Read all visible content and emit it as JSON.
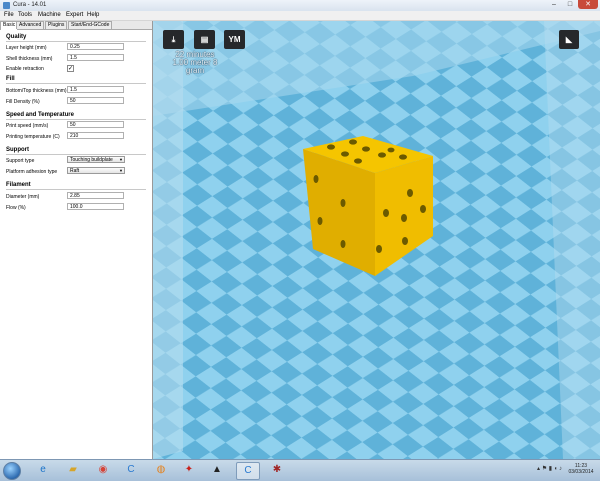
{
  "window": {
    "title": "Cura - 14.01",
    "minimize": "–",
    "maximize": "□",
    "close": "✕"
  },
  "menu": [
    "File",
    "Tools",
    "Machine",
    "Expert",
    "Help"
  ],
  "tabs": [
    "Basic",
    "Advanced",
    "Plugins",
    "Start/End-GCode"
  ],
  "sections": {
    "quality": {
      "title": "Quality",
      "layer_height": {
        "label": "Layer height (mm)",
        "value": "0.25"
      },
      "shell_thickness": {
        "label": "Shell thickness (mm)",
        "value": "1.5"
      },
      "retraction": {
        "label": "Enable retraction",
        "checked": "✓"
      }
    },
    "fill": {
      "title": "Fill",
      "bottom_top": {
        "label": "Bottom/Top thickness (mm)",
        "value": "1.5"
      },
      "density": {
        "label": "Fill Density (%)",
        "value": "50"
      }
    },
    "speed": {
      "title": "Speed and Temperature",
      "print_speed": {
        "label": "Print speed (mm/s)",
        "value": "50"
      },
      "temperature": {
        "label": "Printing temperature (C)",
        "value": "210"
      }
    },
    "support": {
      "title": "Support",
      "support_type": {
        "label": "Support type",
        "value": "Touching buildplate"
      },
      "adhesion": {
        "label": "Platform adhesion type",
        "value": "Raft"
      }
    },
    "filament": {
      "title": "Filament",
      "diameter": {
        "label": "Diameter (mm)",
        "value": "2.85"
      },
      "flow": {
        "label": "Flow (%)",
        "value": "100.0"
      }
    }
  },
  "viewport": {
    "print_time": "22 minutes",
    "print_material": "1.00 meter 8 gram",
    "ym_button": "YM",
    "colors": {
      "floor_light": "#8fd1ee",
      "floor_dark": "#5fb2d9",
      "die": "#f5c500",
      "die_shade": "#e0ae00",
      "die_side": "#d9a900",
      "pip": "#6b5a00"
    }
  },
  "taskbar": {
    "icons": [
      "ie-icon",
      "folder-icon",
      "chrome-icon",
      "cura-icon",
      "firefox-icon",
      "acrobat-icon",
      "inkscape-icon",
      "cura-active-icon",
      "spider-icon"
    ],
    "clock_time": "11:23",
    "clock_date": "03/03/2014"
  }
}
